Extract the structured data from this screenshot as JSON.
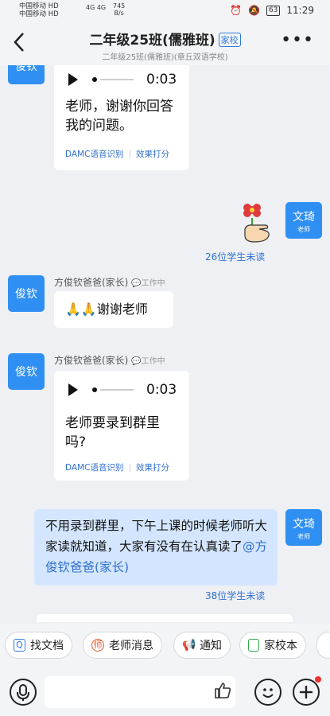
{
  "status_bar": {
    "carrier1": "中国移动 HD",
    "carrier2": "中国移动 HD",
    "network": "4G 4G",
    "speed_value": "745",
    "speed_unit": "B/s",
    "battery": "63",
    "time": "11:29"
  },
  "header": {
    "title": "二年级25班(儒雅班)",
    "tag": "家校",
    "subtitle": "二年级25班(儒雅班)(章丘双语学校)",
    "back_icon": "chevron-left-icon",
    "more_icon": "more-dots-icon"
  },
  "messages": {
    "m1": {
      "avatar": "俊钦",
      "duration": "0:03",
      "text": "老师，谢谢你回答我的问题。",
      "link1": "DAMC语音识别",
      "link2": "效果打分"
    },
    "m2": {
      "avatar_name": "文琦",
      "avatar_role": "老师",
      "sticker_icon": "flower-hand-sticker-icon",
      "read_count": "26位学生未读"
    },
    "m3": {
      "avatar": "俊钦",
      "sender": "方俊钦爸爸(家长)",
      "status": "工作中",
      "text": "🙏🙏谢谢老师"
    },
    "m4": {
      "avatar": "俊钦",
      "sender": "方俊钦爸爸(家长)",
      "status": "工作中",
      "duration": "0:03",
      "text": "老师要录到群里吗?",
      "link1": "DAMC语音识别",
      "link2": "效果打分"
    },
    "m5": {
      "avatar_name": "文琦",
      "avatar_role": "老师",
      "text": "不用录到群里，下午上课的时候老师听大家读就知道，大家有没有在认真读了",
      "mention": "@方俊钦爸爸(家长)",
      "read_count": "38位学生未读"
    }
  },
  "shortcuts": [
    {
      "label": "找文档",
      "icon": "document-search-icon",
      "color": "#2f7be0"
    },
    {
      "label": "老师消息",
      "icon": "teacher-icon",
      "color": "#e85a2c"
    },
    {
      "label": "通知",
      "icon": "megaphone-icon",
      "color": "#e85a2c"
    },
    {
      "label": "家校本",
      "icon": "notebook-icon",
      "color": "#2aa84a"
    }
  ],
  "input_bar": {
    "voice_icon": "microphone-icon",
    "like_icon": "thumbs-up-icon",
    "emoji_icon": "smiley-icon",
    "plus_icon": "plus-icon"
  }
}
